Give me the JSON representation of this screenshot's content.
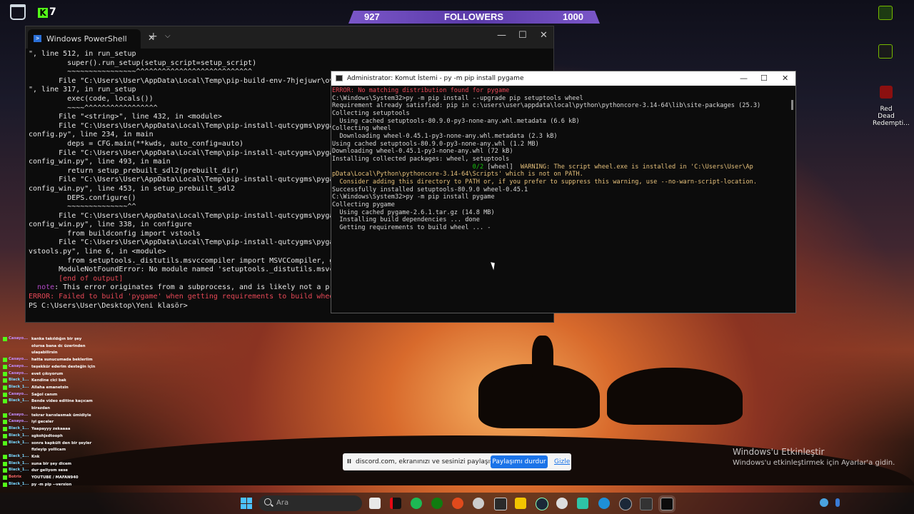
{
  "desktop": {
    "kick_count": "7",
    "followers": {
      "current": "927",
      "label": "FOLLOWERS",
      "goal": "1000",
      "progress_fraction": 0.927
    },
    "right_icon_label": "Red Dead Redempti..."
  },
  "powershell": {
    "tab_title": "Windows PowerShell",
    "lines": [
      {
        "t": "\", line 512, in run_setup",
        "c": ""
      },
      {
        "t": "         super().run_setup(setup_script=setup_script)",
        "c": ""
      },
      {
        "t": "         ~~~~~~~~~~~~~~~~^^^^^^^^^^^^^^^^^^^^^^^^^^^",
        "c": ""
      },
      {
        "t": "       File \"C:\\Users\\User\\AppData\\Local\\Temp\\pip-build-env-7hjejuwr\\overlay\\Lib\\site-packages\\setuptools\\build_meta.py",
        "c": ""
      },
      {
        "t": "\", line 317, in run_setup",
        "c": ""
      },
      {
        "t": "         exec(code, locals())",
        "c": ""
      },
      {
        "t": "         ~~~~^^^^^^^^^^^^^^^^^",
        "c": ""
      },
      {
        "t": "       File \"<string>\", line 432, in <module>",
        "c": ""
      },
      {
        "t": "       File \"C:\\Users\\User\\AppData\\Local\\Temp\\pip-install-qutcygms\\pygame_",
        "c": ""
      },
      {
        "t": "config.py\", line 234, in main",
        "c": ""
      },
      {
        "t": "         deps = CFG.main(**kwds, auto_config=auto)",
        "c": ""
      },
      {
        "t": "       File \"C:\\Users\\User\\AppData\\Local\\Temp\\pip-install-qutcygms\\pygame_",
        "c": ""
      },
      {
        "t": "config_win.py\", line 493, in main",
        "c": ""
      },
      {
        "t": "         return setup_prebuilt_sdl2(prebuilt_dir)",
        "c": ""
      },
      {
        "t": "       File \"C:\\Users\\User\\AppData\\Local\\Temp\\pip-install-qutcygms\\pygame_",
        "c": ""
      },
      {
        "t": "config_win.py\", line 453, in setup_prebuilt_sdl2",
        "c": ""
      },
      {
        "t": "         DEPS.configure()",
        "c": ""
      },
      {
        "t": "         ~~~~~~~~~~~~~~^^",
        "c": ""
      },
      {
        "t": "       File \"C:\\Users\\User\\AppData\\Local\\Temp\\pip-install-qutcygms\\pygame_",
        "c": ""
      },
      {
        "t": "config_win.py\", line 338, in configure",
        "c": ""
      },
      {
        "t": "         from buildconfig import vstools",
        "c": ""
      },
      {
        "t": "       File \"C:\\Users\\User\\AppData\\Local\\Temp\\pip-install-qutcygms\\pygame_",
        "c": ""
      },
      {
        "t": "vstools.py\", line 6, in <module>",
        "c": ""
      },
      {
        "t": "         from setuptools._distutils.msvccompiler import MSVCCompiler, get_",
        "c": ""
      },
      {
        "t": "       ModuleNotFoundError: No module named 'setuptools._distutils.msvccompi",
        "c": ""
      },
      {
        "t": "       [end of output]",
        "c": "r"
      },
      {
        "t": "",
        "c": ""
      },
      {
        "t": "  note: This error originates from a subprocess, and is likely not a pr",
        "c": "note"
      },
      {
        "t": "ERROR: Failed to build 'pygame' when getting requirements to build whee",
        "c": "r"
      },
      {
        "t": "PS C:\\Users\\User\\Desktop\\Yeni klasör> ",
        "c": ""
      }
    ]
  },
  "cmd": {
    "title": "Administrator: Komut İstemi - py  -m pip install pygame",
    "lines": [
      {
        "t": "ERROR: No matching distribution found for pygame",
        "c": "r"
      },
      {
        "t": "",
        "c": ""
      },
      {
        "t": "C:\\Windows\\System32>py -m pip install --upgrade pip setuptools wheel",
        "c": ""
      },
      {
        "t": "Requirement already satisfied: pip in c:\\users\\user\\appdata\\local\\python\\pythoncore-3.14-64\\lib\\site-packages (25.3)",
        "c": ""
      },
      {
        "t": "Collecting setuptools",
        "c": ""
      },
      {
        "t": "  Using cached setuptools-80.9.0-py3-none-any.whl.metadata (6.6 kB)",
        "c": ""
      },
      {
        "t": "Collecting wheel",
        "c": ""
      },
      {
        "t": "  Downloading wheel-0.45.1-py3-none-any.whl.metadata (2.3 kB)",
        "c": ""
      },
      {
        "t": "Using cached setuptools-80.9.0-py3-none-any.whl (1.2 MB)",
        "c": ""
      },
      {
        "t": "Downloading wheel-0.45.1-py3-none-any.whl (72 kB)",
        "c": ""
      },
      {
        "t": "Installing collected packages: wheel, setuptools",
        "c": ""
      },
      {
        "t": "                                      0/2 [wheel]  WARNING: The script wheel.exe is installed in 'C:\\Users\\User\\Ap",
        "c": "warn"
      },
      {
        "t": "pData\\Local\\Python\\pythoncore-3.14-64\\Scripts' which is not on PATH.",
        "c": "y"
      },
      {
        "t": "  Consider adding this directory to PATH or, if you prefer to suppress this warning, use --no-warn-script-location.",
        "c": "y"
      },
      {
        "t": "Successfully installed setuptools-80.9.0 wheel-0.45.1",
        "c": ""
      },
      {
        "t": "",
        "c": ""
      },
      {
        "t": "C:\\Windows\\System32>py -m pip install pygame",
        "c": ""
      },
      {
        "t": "Collecting pygame",
        "c": ""
      },
      {
        "t": "  Using cached pygame-2.6.1.tar.gz (14.8 MB)",
        "c": ""
      },
      {
        "t": "  Installing build dependencies ... done",
        "c": ""
      },
      {
        "t": "  Getting requirements to build wheel ... -",
        "c": ""
      }
    ]
  },
  "chat": [
    {
      "user": "Casayo...",
      "msg": "kanka takıldığın bir şey olursa bana dc üzerinden ulaşabilirsin"
    },
    {
      "user": "Casayo...",
      "msg": "hatta sunucumada bekleriim"
    },
    {
      "user": "Casayo...",
      "msg": "teşekkür ederim desteğin için"
    },
    {
      "user": "Casayo...",
      "msg": "evet çıkıyorum"
    },
    {
      "user": "Black_1...",
      "msg": "Kendine cici bak"
    },
    {
      "user": "Black_1...",
      "msg": "Allaha emanetsin"
    },
    {
      "user": "Casayo...",
      "msg": "Sağol canım"
    },
    {
      "user": "Black_1...",
      "msg": "Bende video editine kaçıcam birazdan"
    },
    {
      "user": "Casayo...",
      "msg": "tekrar karıslasmak ümidiyle"
    },
    {
      "user": "Casayo...",
      "msg": "iyi geceler"
    },
    {
      "user": "Black_1...",
      "msg": "Yaapayyy zekaaaa"
    },
    {
      "user": "Black_1...",
      "msg": "sgkohjsdtooph"
    },
    {
      "user": "Black_1...",
      "msg": "sonra kapkült den bir şeyler fizleyip yollicam"
    },
    {
      "user": "Black_1...",
      "msg": "Knk"
    },
    {
      "user": "Black_1...",
      "msg": "suna bir şey dicem"
    },
    {
      "user": "Black_1...",
      "msg": "dur geliyom sese"
    },
    {
      "user": "Botrix",
      "msg": "YOUTUBE / MAFAN940"
    },
    {
      "user": "Black_1...",
      "msg": "py -m pip --version"
    }
  ],
  "share_banner": {
    "pause": "II",
    "text": "discord.com, ekranınızı ve sesinizi paylaşıyor.",
    "stop_label": "Paylaşımı durdur",
    "hide_label": "Gizle"
  },
  "watermark": {
    "title": "Windows'u Etkinleştir",
    "subtitle": "Windows'u etkinleştirmek için Ayarlar'a gidin."
  },
  "taskbar": {
    "search_placeholder": "Ara",
    "apps": [
      "file-explorer",
      "netflix",
      "spotify",
      "xbox",
      "opera-gx",
      "steam-link",
      "epic-games",
      "yellow-app",
      "steam",
      "github-desktop",
      "copilot",
      "edge",
      "steam-alt",
      "terminal",
      "cmd"
    ]
  }
}
